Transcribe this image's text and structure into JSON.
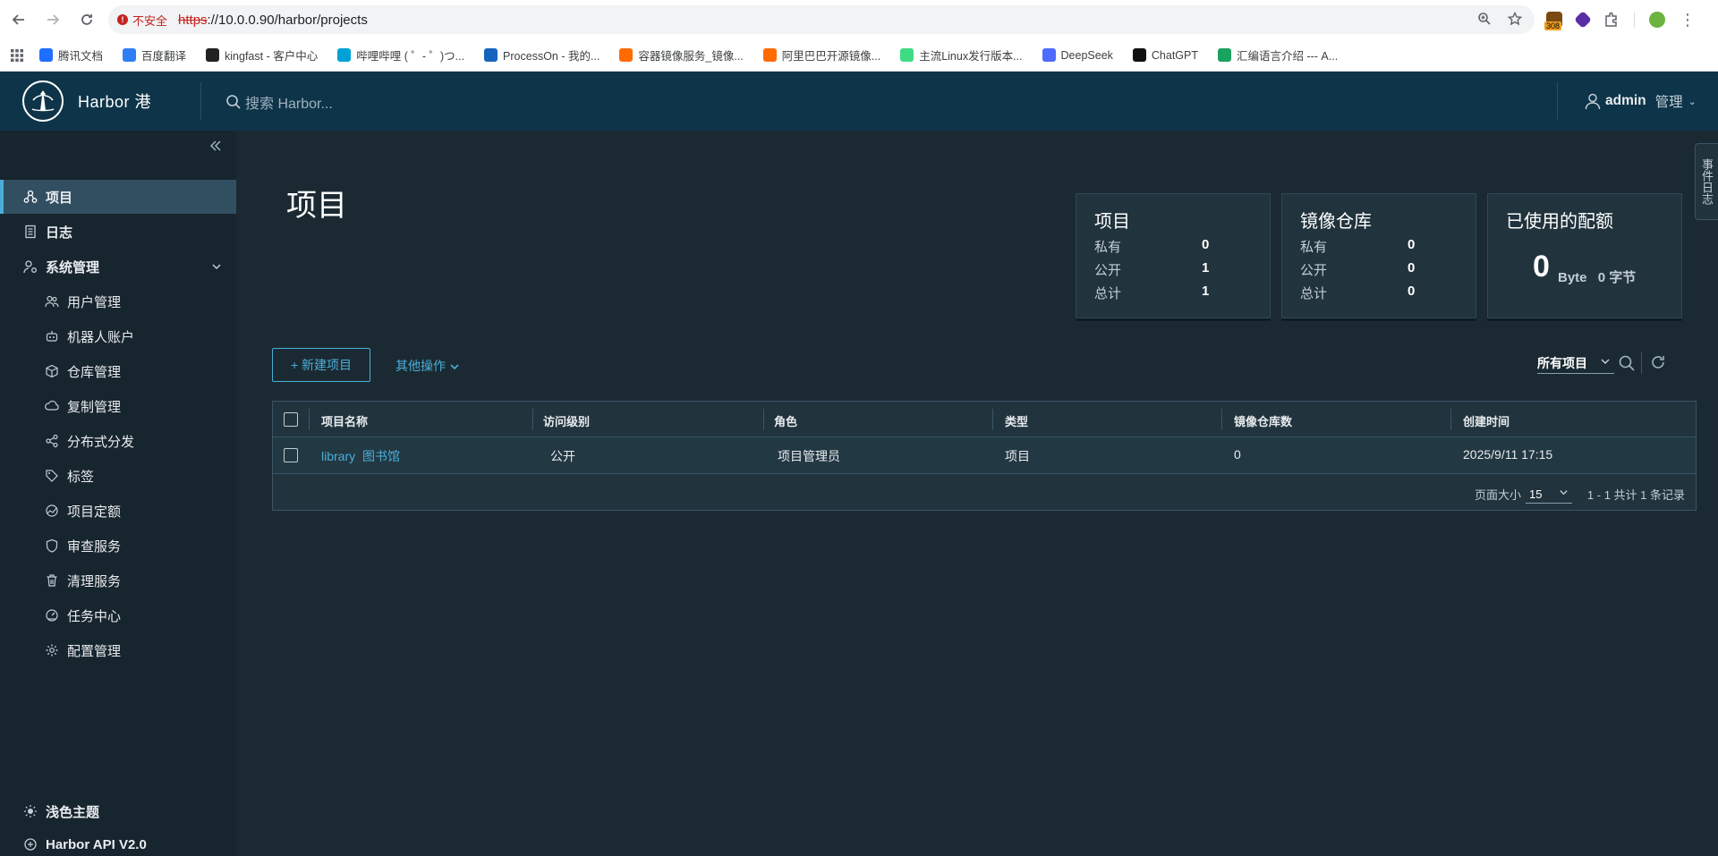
{
  "browser": {
    "security_label": "不安全",
    "url_proto": "https",
    "url_rest": "://10.0.0.90/harbor/projects",
    "ext_badge": "308",
    "bookmarks": [
      {
        "label": "腾讯文档",
        "color": "#1e6fff"
      },
      {
        "label": "百度翻译",
        "color": "#2f7ef5"
      },
      {
        "label": "kingfast - 客户中心",
        "color": "#222222"
      },
      {
        "label": "哔哩哔哩 ( ゜- ゜)つ...",
        "color": "#00a1d6"
      },
      {
        "label": "ProcessOn - 我的...",
        "color": "#1565c0"
      },
      {
        "label": "容器镜像服务_镜像...",
        "color": "#ff6a00"
      },
      {
        "label": "阿里巴巴开源镜像...",
        "color": "#ff6a00"
      },
      {
        "label": "主流Linux发行版本...",
        "color": "#3ddc84"
      },
      {
        "label": "DeepSeek",
        "color": "#4d6bfe"
      },
      {
        "label": "ChatGPT",
        "color": "#111111"
      },
      {
        "label": "汇编语言介绍 --- A...",
        "color": "#1aa260"
      }
    ]
  },
  "header": {
    "brand": "Harbor 港",
    "search_placeholder": "搜索 Harbor...",
    "user": "admin",
    "manage": "管理"
  },
  "sidebar": {
    "items": [
      {
        "label": "项目",
        "icon": "projects-icon"
      },
      {
        "label": "日志",
        "icon": "logs-icon"
      },
      {
        "label": "系统管理",
        "icon": "admin-icon"
      }
    ],
    "sub_items": [
      {
        "label": "用户管理",
        "icon": "users-icon"
      },
      {
        "label": "机器人账户",
        "icon": "robot-icon"
      },
      {
        "label": "仓库管理",
        "icon": "registry-icon"
      },
      {
        "label": "复制管理",
        "icon": "replication-icon"
      },
      {
        "label": "分布式分发",
        "icon": "share-icon"
      },
      {
        "label": "标签",
        "icon": "tag-icon"
      },
      {
        "label": "项目定额",
        "icon": "quota-icon"
      },
      {
        "label": "审查服务",
        "icon": "shield-icon"
      },
      {
        "label": "清理服务",
        "icon": "trash-icon"
      },
      {
        "label": "任务中心",
        "icon": "dashboard-icon"
      },
      {
        "label": "配置管理",
        "icon": "gear-icon"
      }
    ],
    "footer": {
      "theme": "浅色主题",
      "api": "Harbor API V2.0"
    }
  },
  "main": {
    "title": "项目",
    "cards": {
      "projects": {
        "title": "项目",
        "rows": [
          {
            "label": "私有",
            "value": "0"
          },
          {
            "label": "公开",
            "value": "1"
          },
          {
            "label": "总计",
            "value": "1"
          }
        ]
      },
      "repos": {
        "title": "镜像仓库",
        "rows": [
          {
            "label": "私有",
            "value": "0"
          },
          {
            "label": "公开",
            "value": "0"
          },
          {
            "label": "总计",
            "value": "0"
          }
        ]
      },
      "quota": {
        "title": "已使用的配额",
        "value": "0",
        "unit": "Byte",
        "unit2": "0 字节"
      }
    },
    "new_project": "+ 新建项目",
    "more_actions": "其他操作",
    "filter": "所有项目",
    "table": {
      "headers": [
        "项目名称",
        "访问级别",
        "角色",
        "类型",
        "镜像仓库数",
        "创建时间"
      ],
      "rows": [
        {
          "name": "library",
          "name_suffix": "图书馆",
          "access": "公开",
          "role": "项目管理员",
          "type": "项目",
          "repo_count": "0",
          "created": "2025/9/11 17:15"
        }
      ],
      "page_size_label": "页面大小",
      "page_size": "15",
      "page_info": "1 - 1 共计 1 条记录"
    },
    "side_tab": "事件日志"
  }
}
